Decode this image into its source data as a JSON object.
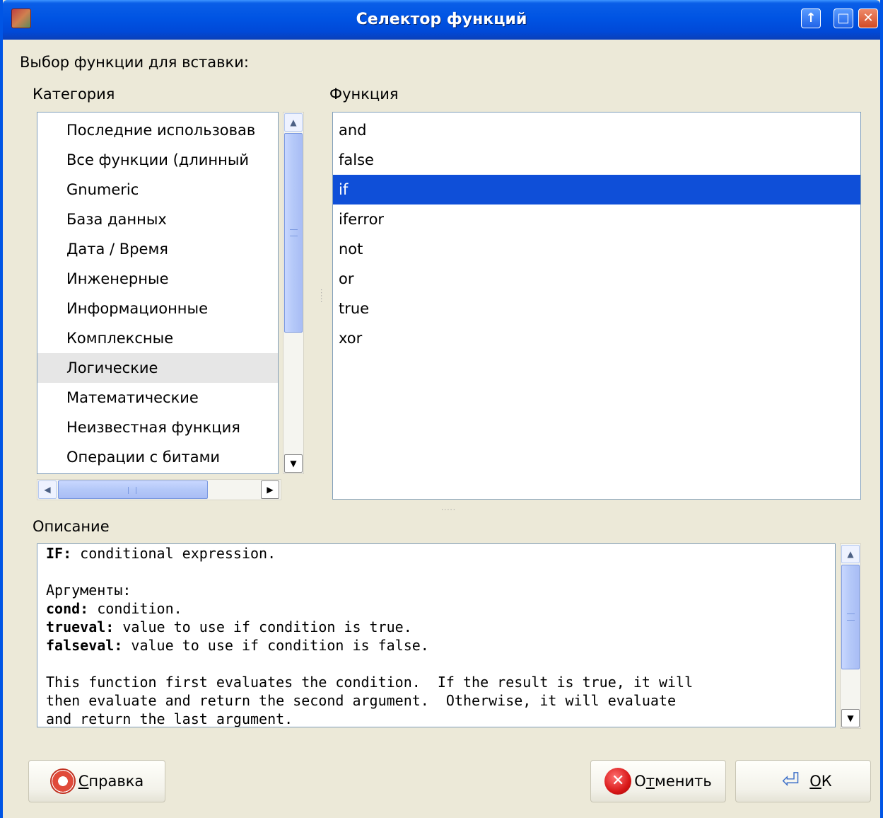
{
  "window": {
    "title": "Селектор функций",
    "title_buttons": {
      "help": "↑",
      "maximize": "□",
      "close": "✕"
    },
    "colors": {
      "titlebar": "#0054e3",
      "selection": "#0f4fd8",
      "face": "#ece9d8"
    }
  },
  "prompt": "Выбор функции для вставки:",
  "category": {
    "label": "Категория",
    "items": [
      "Последние использовав",
      "Все функции (длинный",
      "Gnumeric",
      "База данных",
      "Дата / Время",
      "Инженерные",
      "Информационные",
      "Комплексные",
      "Логические",
      "Математические",
      "Неизвестная функция",
      "Операции с битами"
    ],
    "selected": "Логические"
  },
  "function": {
    "label": "Функция",
    "items": [
      "and",
      "false",
      "if",
      "iferror",
      "not",
      "or",
      "true",
      "xor"
    ],
    "selected": "if"
  },
  "description": {
    "label": "Описание",
    "lines": [
      {
        "bold": "IF:",
        "text": " conditional expression."
      },
      {
        "bold": "",
        "text": ""
      },
      {
        "bold": "",
        "text": "Аргументы:"
      },
      {
        "bold": "cond:",
        "text": " condition."
      },
      {
        "bold": "trueval:",
        "text": " value to use if condition is true."
      },
      {
        "bold": "falseval:",
        "text": " value to use if condition is false."
      },
      {
        "bold": "",
        "text": ""
      },
      {
        "bold": "",
        "text": "This function first evaluates the condition.  If the result is true, it will"
      },
      {
        "bold": "",
        "text": "then evaluate and return the second argument.  Otherwise, it will evaluate"
      },
      {
        "bold": "",
        "text": "and return the last argument."
      }
    ]
  },
  "buttons": {
    "help": {
      "mnemonic": "С",
      "rest": "правка",
      "icon": "lifebuoy-icon"
    },
    "cancel": {
      "before": "О",
      "mnemonic": "т",
      "rest": "менить",
      "icon": "cancel-icon"
    },
    "ok": {
      "mnemonic": "О",
      "rest": "К",
      "icon": "ok-arrow-icon"
    }
  }
}
